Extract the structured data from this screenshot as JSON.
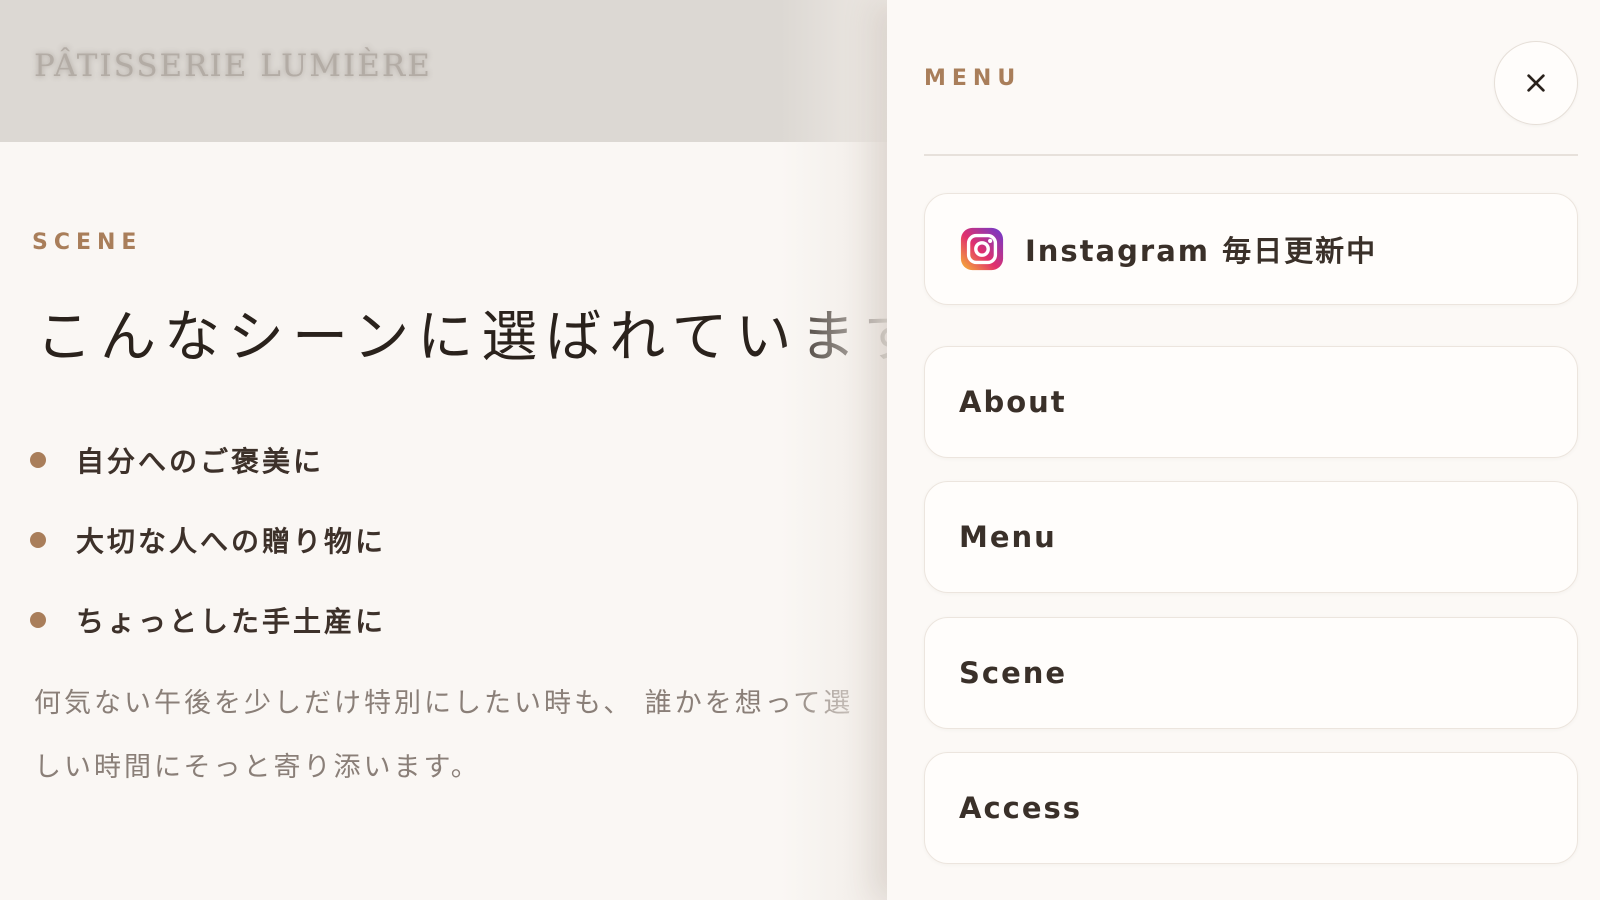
{
  "header": {
    "brand": "PÂTISSERIE LUMIÈRE"
  },
  "scene": {
    "eyebrow": "SCENE",
    "heading": "こんなシーンに選ばれています",
    "bullets": [
      "自分へのご褒美に",
      "大切な人への贈り物に",
      "ちょっとした手土産に"
    ],
    "body_line1": "何気ない午後を少しだけ特別にしたい時も、 誰かを想って選",
    "body_line2": "しい時間にそっと寄り添います。"
  },
  "drawer": {
    "title": "MENU",
    "close_icon": "close-icon",
    "instagram": {
      "label": "Instagram 毎日更新中",
      "icon": "instagram-icon"
    },
    "items": [
      {
        "label": "About"
      },
      {
        "label": "Menu"
      },
      {
        "label": "Scene"
      },
      {
        "label": "Access"
      }
    ]
  },
  "colors": {
    "accent": "#a97e5a",
    "background": "#faf7f4",
    "header_overlay": "#dcd8d3",
    "text_dark": "#2a221c",
    "text_muted": "#8a7f78"
  }
}
